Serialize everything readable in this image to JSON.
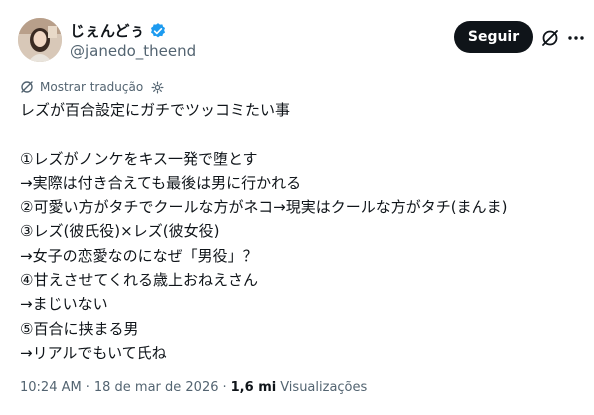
{
  "author": {
    "display_name": "じぇんどぅ",
    "handle": "@janedo_theend"
  },
  "actions": {
    "follow_label": "Seguir",
    "grok_icon": "grok-icon",
    "more_icon": "more-icon"
  },
  "translate": {
    "label": "Mostrar tradução"
  },
  "tweet": {
    "lines": [
      "レズが百合設定にガチでツッコミたい事",
      "",
      "①レズがノンケをキス一発で堕とす",
      "→実際は付き合えても最後は男に行かれる",
      "②可愛い方がタチでクールな方がネコ→現実はクールな方がタチ(まんま)",
      "③レズ(彼氏役)×レズ(彼女役)",
      "→女子の恋愛なのになぜ「男役」？",
      "④甘えさせてくれる歳上おねえさん",
      "→まじいない",
      "⑤百合に挟まる男",
      "→リアルでもいて氏ね"
    ]
  },
  "meta": {
    "time": "10:24 AM",
    "date": "18 de mar de 2026",
    "dot1": "·",
    "dot2": "·",
    "views_count": "1,6 mi",
    "views_label": "Visualizações"
  },
  "colors": {
    "verified": "#1d9bf0",
    "follow_bg": "#0f1419",
    "secondary_text": "#536471"
  }
}
